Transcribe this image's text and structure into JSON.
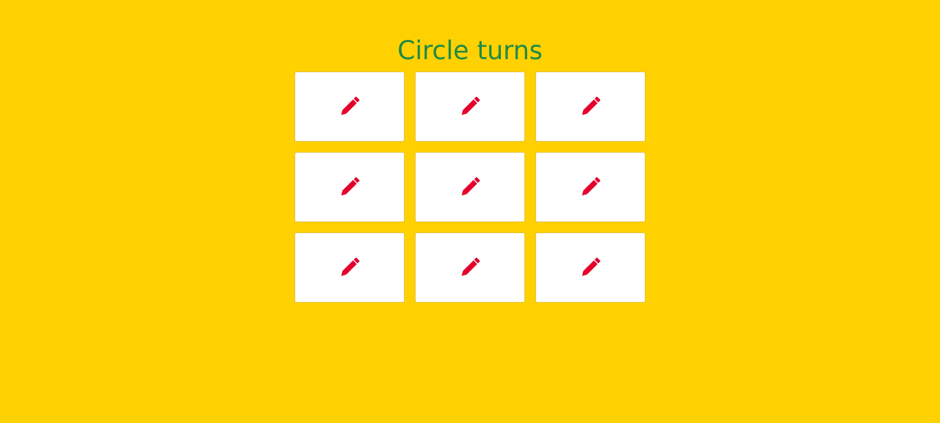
{
  "title": "Circle turns",
  "colors": {
    "background": "#ffd100",
    "title": "#1f8a47",
    "cell": "#ffffff",
    "icon": "#e4002b"
  },
  "board": {
    "cells": [
      {
        "icon": "pencil-icon"
      },
      {
        "icon": "pencil-icon"
      },
      {
        "icon": "pencil-icon"
      },
      {
        "icon": "pencil-icon"
      },
      {
        "icon": "pencil-icon"
      },
      {
        "icon": "pencil-icon"
      },
      {
        "icon": "pencil-icon"
      },
      {
        "icon": "pencil-icon"
      },
      {
        "icon": "pencil-icon"
      }
    ]
  }
}
